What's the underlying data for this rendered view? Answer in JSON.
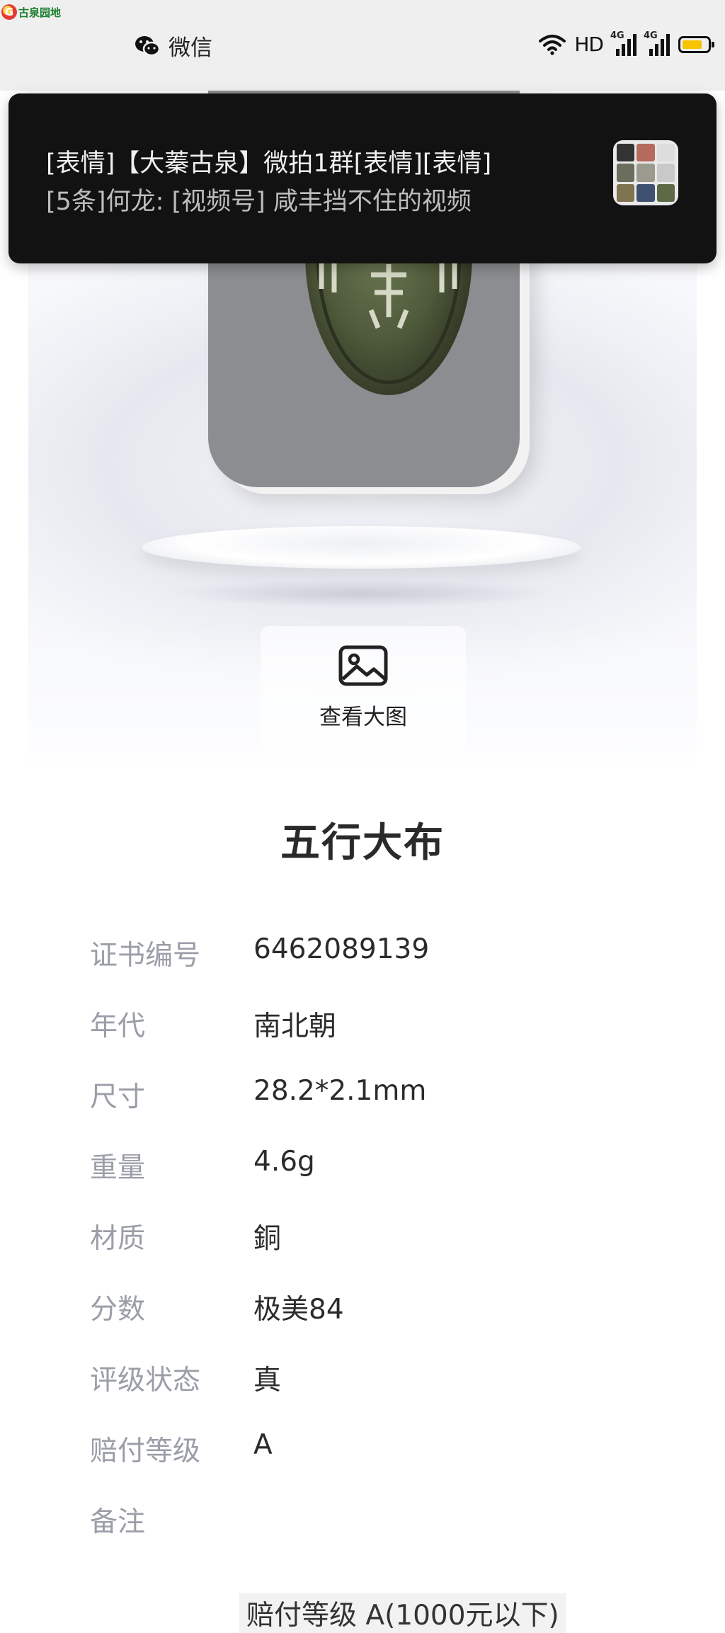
{
  "watermark": {
    "text": "古泉园地"
  },
  "status_bar": {
    "app_name": "微信",
    "hd_label": "HD",
    "signal1_label": "4G",
    "signal2_label": "4G",
    "battery_level": 0.8,
    "battery_color": "#f6c400"
  },
  "notification": {
    "line1": "[表情]【大蓁古泉】微拍1群[表情][表情]",
    "line2": "[5条]何龙: [视频号] 咸丰挡不住的视频"
  },
  "hero": {
    "view_large_label": "查看大图"
  },
  "item": {
    "title": "五行大布",
    "fields": [
      {
        "label": "证书编号",
        "value": "6462089139"
      },
      {
        "label": "年代",
        "value": "南北朝"
      },
      {
        "label": "尺寸",
        "value": "28.2*2.1mm"
      },
      {
        "label": "重量",
        "value": "4.6g"
      },
      {
        "label": "材质",
        "value": "銅"
      },
      {
        "label": "分数",
        "value": "极美84"
      },
      {
        "label": "评级状态",
        "value": "真"
      },
      {
        "label": "赔付等级",
        "value": "A"
      },
      {
        "label": "备注",
        "value": ""
      }
    ],
    "footer_partial": "赔付等级 A(1000元以下)"
  }
}
